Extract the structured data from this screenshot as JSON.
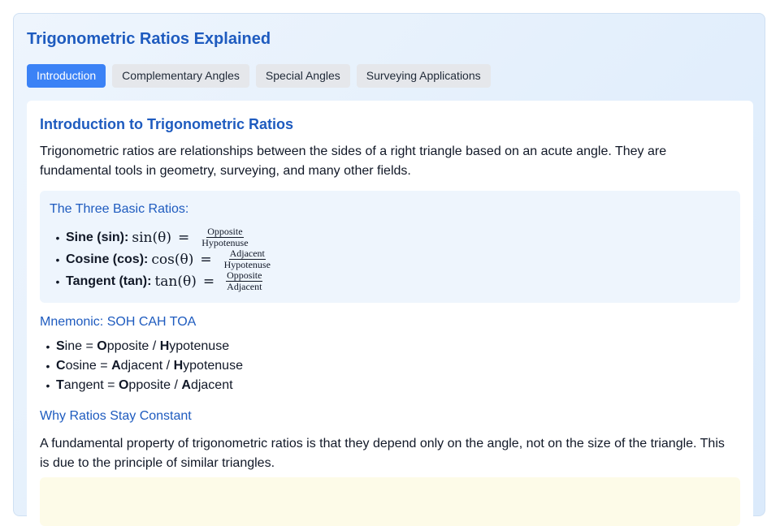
{
  "app": {
    "title": "Trigonometric Ratios Explained"
  },
  "tabs": [
    {
      "label": "Introduction",
      "active": true
    },
    {
      "label": "Complementary Angles",
      "active": false
    },
    {
      "label": "Special Angles",
      "active": false
    },
    {
      "label": "Surveying Applications",
      "active": false
    }
  ],
  "section": {
    "heading": "Introduction to Trigonometric Ratios",
    "intro": "Trigonometric ratios are relationships between the sides of a right triangle based on an acute angle. They are fundamental tools in geometry, surveying, and many other fields."
  },
  "ratios": {
    "heading": "The Three Basic Ratios:",
    "items": [
      {
        "name": "Sine (sin):",
        "func": "sin(θ)",
        "eq": "=",
        "numerator": "Opposite",
        "denominator": "Hypotenuse"
      },
      {
        "name": "Cosine (cos):",
        "func": "cos(θ)",
        "eq": "=",
        "numerator": "Adjacent",
        "denominator": "Hypotenuse"
      },
      {
        "name": "Tangent (tan):",
        "func": "tan(θ)",
        "eq": "=",
        "numerator": "Opposite",
        "denominator": "Adjacent"
      }
    ]
  },
  "mnemonic": {
    "heading": "Mnemonic: SOH CAH TOA",
    "items": [
      {
        "w1_first": "S",
        "w1_rest": "ine",
        "w2_first": "O",
        "w2_rest": "pposite",
        "w3_first": "H",
        "w3_rest": "ypotenuse"
      },
      {
        "w1_first": "C",
        "w1_rest": "osine",
        "w2_first": "A",
        "w2_rest": "djacent",
        "w3_first": "H",
        "w3_rest": "ypotenuse"
      },
      {
        "w1_first": "T",
        "w1_rest": "angent",
        "w2_first": "O",
        "w2_rest": "pposite",
        "w3_first": "A",
        "w3_rest": "djacent"
      }
    ],
    "equals": "=",
    "slash": "/"
  },
  "constant": {
    "heading": "Why Ratios Stay Constant",
    "text": "A fundamental property of trigonometric ratios is that they depend only on the angle, not on the size of the triangle. This is due to the principle of similar triangles."
  },
  "bullet": "•"
}
